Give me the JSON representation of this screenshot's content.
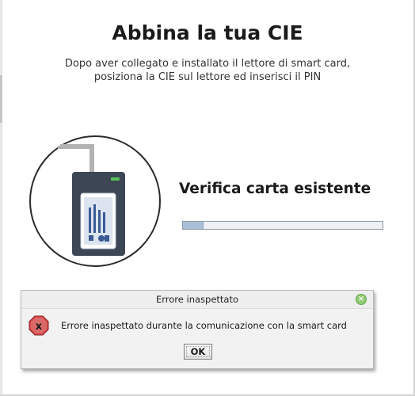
{
  "page": {
    "title": "Abbina la tua CIE",
    "subtitle_line1": "Dopo aver collegato e installato il lettore di smart card,",
    "subtitle_line2": "posiziona la CIE sul lettore ed inserisci il PIN"
  },
  "status": {
    "label": "Verifica carta esistente",
    "progress_percent": 10
  },
  "dialog": {
    "title": "Errore inaspettato",
    "message": "Errore inaspettato durante la comunicazione con la smart card",
    "ok_label": "OK",
    "error_icon_glyph": "x"
  },
  "colors": {
    "error_icon": "#d64a4a",
    "progress_fill": "#a9bfd6",
    "close_button": "#8fcb6f",
    "reader_body": "#3d4654",
    "reader_led": "#58c257"
  }
}
